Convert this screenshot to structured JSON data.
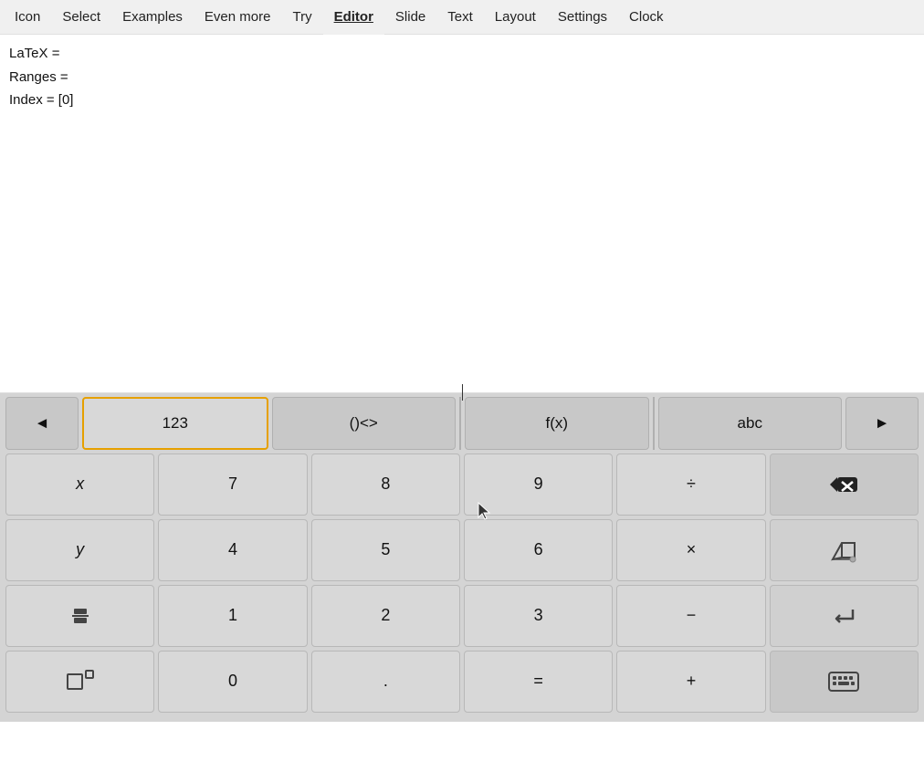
{
  "nav": {
    "items": [
      {
        "label": "Icon",
        "active": false
      },
      {
        "label": "Select",
        "active": false
      },
      {
        "label": "Examples",
        "active": false
      },
      {
        "label": "Even more",
        "active": false
      },
      {
        "label": "Try",
        "active": false
      },
      {
        "label": "Editor",
        "active": true
      },
      {
        "label": "Slide",
        "active": false
      },
      {
        "label": "Text",
        "active": false
      },
      {
        "label": "Layout",
        "active": false
      },
      {
        "label": "Settings",
        "active": false
      },
      {
        "label": "Clock",
        "active": false
      }
    ]
  },
  "info": {
    "latex_label": "LaTeX =",
    "ranges_label": "Ranges =",
    "index_label": "Index = [0]"
  },
  "keyboard": {
    "arrow_left": "◄",
    "btn_123": "123",
    "btn_paren": "()<>",
    "btn_fx": "f(x)",
    "btn_abc": "abc",
    "arrow_right": "►",
    "rows": [
      [
        {
          "label": "x",
          "italic": true
        },
        {
          "label": "7"
        },
        {
          "label": "8"
        },
        {
          "label": "9"
        },
        {
          "label": "÷"
        },
        {
          "label": "⌫",
          "type": "backspace"
        }
      ],
      [
        {
          "label": "y",
          "italic": true
        },
        {
          "label": "4"
        },
        {
          "label": "5"
        },
        {
          "label": "6"
        },
        {
          "label": "×"
        },
        {
          "label": "◇",
          "type": "eraser"
        }
      ],
      [
        {
          "label": "fraction",
          "type": "fraction"
        },
        {
          "label": "1"
        },
        {
          "label": "2"
        },
        {
          "label": "3"
        },
        {
          "label": "−"
        },
        {
          "label": "↵",
          "type": "enter"
        }
      ],
      [
        {
          "label": "exponent",
          "type": "exponent"
        },
        {
          "label": "0"
        },
        {
          "label": "."
        },
        {
          "label": "="
        },
        {
          "label": "+"
        },
        {
          "label": "⌨",
          "type": "keyboard"
        }
      ]
    ]
  }
}
